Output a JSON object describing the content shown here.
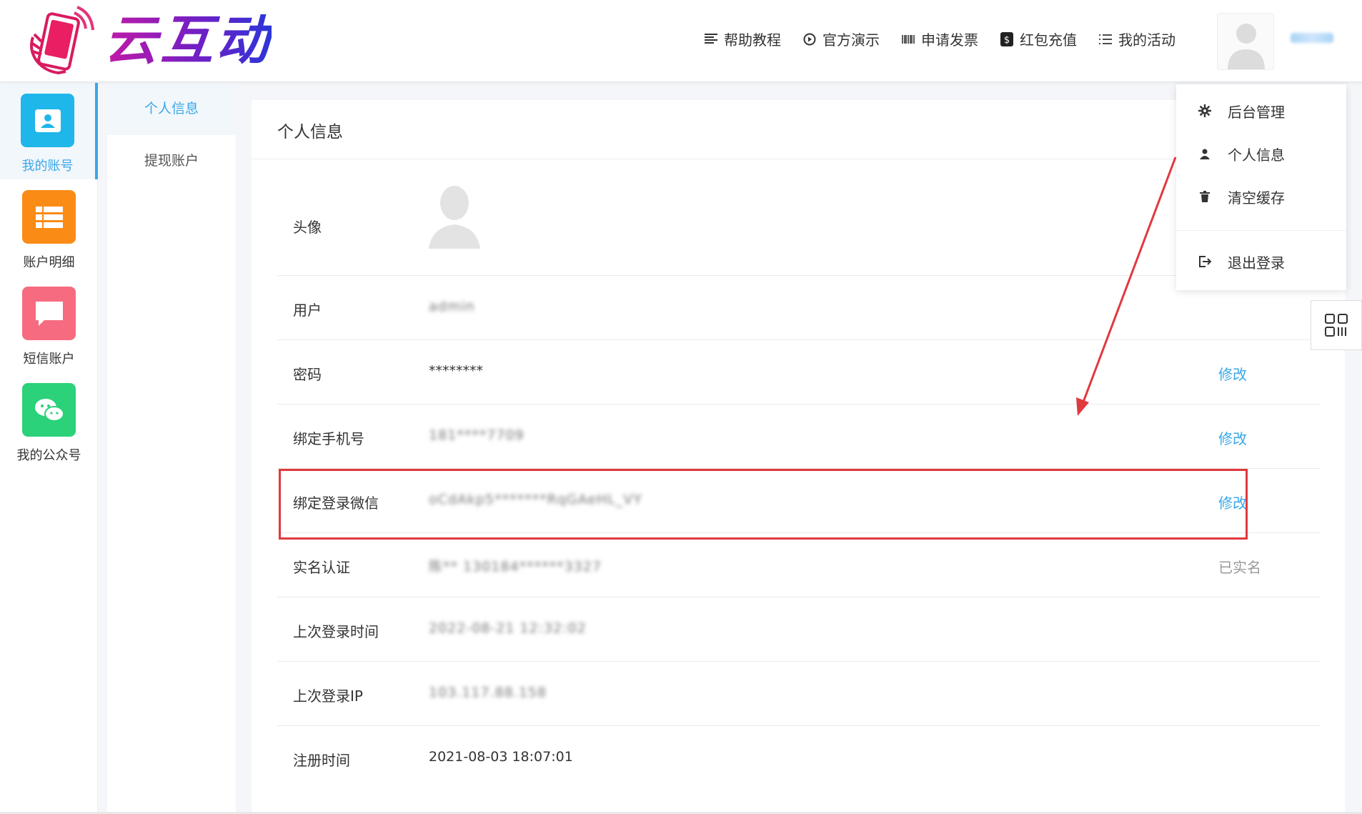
{
  "brand": {
    "name": "云互动"
  },
  "nav": [
    {
      "label": "帮助教程",
      "icon": "list-icon"
    },
    {
      "label": "官方演示",
      "icon": "play-icon"
    },
    {
      "label": "申请发票",
      "icon": "barcode-icon"
    },
    {
      "label": "红包充值",
      "icon": "dollar-icon"
    },
    {
      "label": "我的活动",
      "icon": "list-bullet-icon"
    }
  ],
  "sidebar": {
    "items": [
      {
        "label": "我的账号",
        "icon": "account-card-icon",
        "color": "#1fb6ea"
      },
      {
        "label": "账户明细",
        "icon": "table-list-icon",
        "color": "#fa8c16"
      },
      {
        "label": "短信账户",
        "icon": "message-icon",
        "color": "#f66b80"
      },
      {
        "label": "我的公众号",
        "icon": "wechat-icon",
        "color": "#2bd27a"
      }
    ]
  },
  "submenu": {
    "items": [
      "个人信息",
      "提现账户"
    ]
  },
  "card": {
    "title": "个人信息",
    "rows": {
      "avatar": {
        "label": "头像"
      },
      "user": {
        "label": "用户",
        "value": "admin"
      },
      "password": {
        "label": "密码",
        "value": "********",
        "action": "修改"
      },
      "phone": {
        "label": "绑定手机号",
        "value": "181****7709",
        "action": "修改"
      },
      "wechat": {
        "label": "绑定登录微信",
        "value": "oCdAkp5*******RqGAeHL_VY",
        "action": "修改"
      },
      "realname": {
        "label": "实名认证",
        "value": "陈** 130184******3327",
        "action": "已实名"
      },
      "last_login_time": {
        "label": "上次登录时间",
        "value": "2022-08-21 12:32:02"
      },
      "last_login_ip": {
        "label": "上次登录IP",
        "value": "103.117.88.158"
      },
      "register_time": {
        "label": "注册时间",
        "value": "2021-08-03 18:07:01"
      }
    }
  },
  "dropdown": {
    "items": [
      {
        "label": "后台管理",
        "icon": "gear-icon"
      },
      {
        "label": "个人信息",
        "icon": "user-icon"
      },
      {
        "label": "清空缓存",
        "icon": "trash-icon"
      },
      {
        "label": "退出登录",
        "icon": "logout-icon"
      }
    ]
  },
  "colors": {
    "accent": "#3aa7e8",
    "highlight": "#e0393e"
  }
}
